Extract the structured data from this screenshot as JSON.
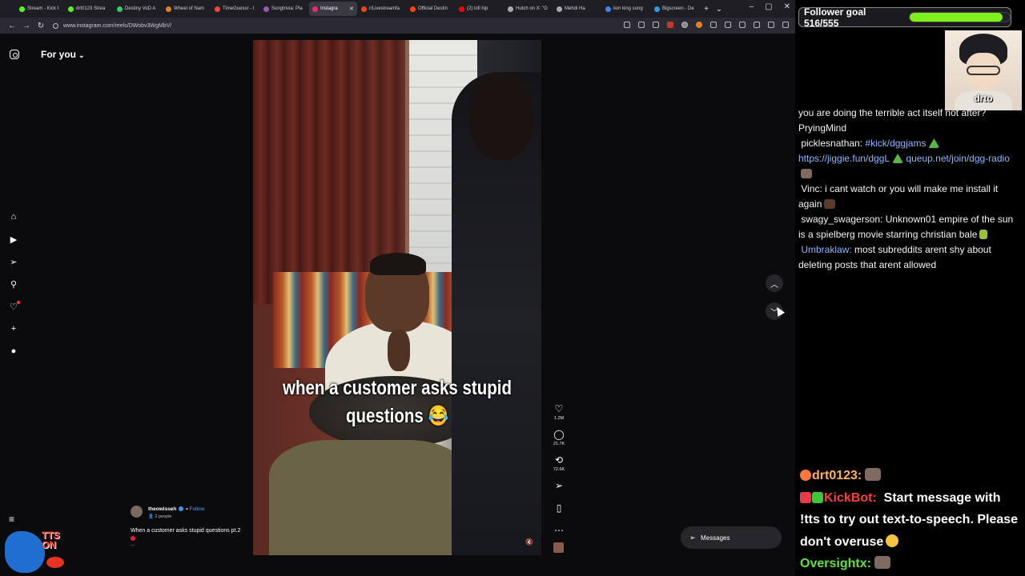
{
  "browser": {
    "tabs": [
      {
        "label": "Stream - Kick I",
        "color": "#53fc18",
        "active": false
      },
      {
        "label": "drt0123 Strea",
        "color": "#53fc18",
        "active": false
      },
      {
        "label": "Destiny VoD A",
        "color": "#2ecc71",
        "active": false
      },
      {
        "label": "Wheel of Nam",
        "color": "#e67e22",
        "active": false
      },
      {
        "label": "TimeGuessr - I",
        "color": "#e74c3c",
        "active": false
      },
      {
        "label": "Songtrivia: Pla",
        "color": "#9b59b6",
        "active": false
      },
      {
        "label": "Instagra",
        "color": "#e1306c",
        "active": true
      },
      {
        "label": "r/Livestreamfa",
        "color": "#ff4500",
        "active": false
      },
      {
        "label": "Official Destin",
        "color": "#ff4500",
        "active": false
      },
      {
        "label": "(2) lofi hip",
        "color": "#ff0000",
        "active": false
      },
      {
        "label": "Hutch on X: \"G",
        "color": "#aaaaaa",
        "active": false
      },
      {
        "label": "Mehdi Ha",
        "color": "#aaaaaa",
        "active": false
      },
      {
        "label": "lion king song",
        "color": "#4285f4",
        "active": false
      },
      {
        "label": "Bigscreen - De",
        "color": "#3498db",
        "active": false
      }
    ],
    "new_tab": "+",
    "tab_list": "⌄",
    "url": "www.instagram.com/reels/DWobv3WgMbV/",
    "win_minimize": "–",
    "win_maximize": "▢",
    "win_close": "✕",
    "back": "←",
    "forward": "→",
    "reload": "↻"
  },
  "instagram": {
    "feed_title": "For you",
    "caption_line1": "when a customer asks stupid",
    "caption_line2": "questions 😂",
    "author": {
      "username": "theowisseh",
      "follow": "Follow",
      "audience": "2 people",
      "description": "When a customer asks stupid questions pt.2",
      "more": "..."
    },
    "actions": {
      "likes": "1.2M",
      "comments": "21.7K",
      "reposts": "72.6K"
    },
    "messages_label": "Messages"
  },
  "overlay": {
    "goal_label": "Follower goal 516/555",
    "goal_progress": 0.93,
    "cam_label": "drto",
    "chat": [
      {
        "user": "",
        "text": "you are doing the terrible act itself not after?",
        "emotes": []
      },
      {
        "user": "",
        "text": "PryingMind",
        "emotes": []
      },
      {
        "user": "picklesnathan:",
        "text": "#kick/dggjams",
        "link": "https://jiggie.fun/dggL",
        "link2": "queup.net/join/dgg-radio"
      },
      {
        "user": "Vinc:",
        "text": "i cant watch or you will make me install it again"
      },
      {
        "user": "swagy_swagerson:",
        "text": "Unknown01 empire of the sun is a spielberg movie starring christian bale"
      },
      {
        "user": "Umbraklaw:",
        "text": "most subreddits arent shy about deleting posts that arent allowed"
      }
    ],
    "bottom_chat": [
      {
        "user": "drt0123:",
        "text": ""
      },
      {
        "user": "KickBot:",
        "text": "Start message with !tts to try out text-to-speech. Please don't overuse"
      },
      {
        "user": "Oversightx:",
        "text": ""
      }
    ]
  },
  "tts_logo": {
    "line1": "TTS",
    "line2": "ON"
  }
}
